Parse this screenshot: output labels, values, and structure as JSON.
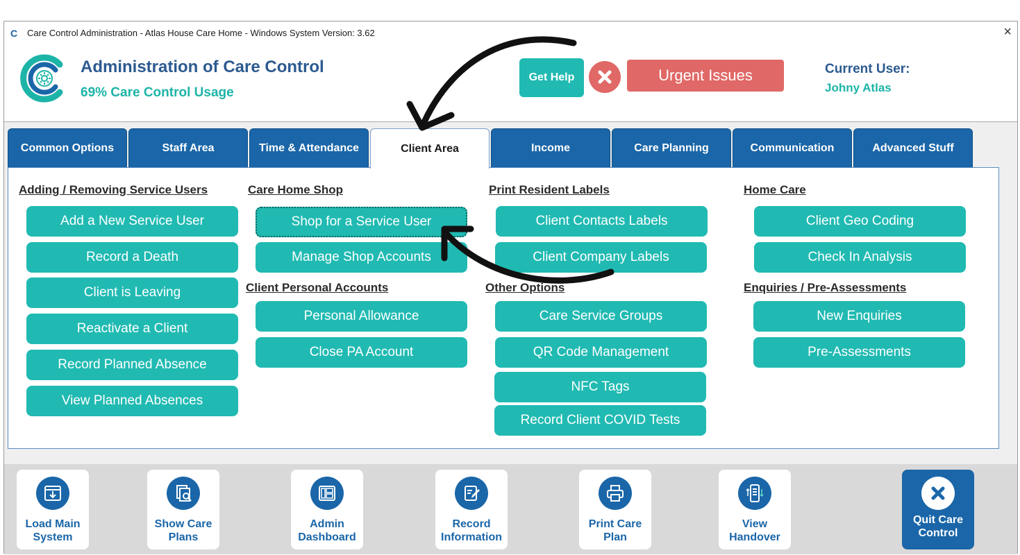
{
  "window": {
    "title": "Care Control Administration - Atlas House Care Home - Windows System Version: 3.62",
    "close_glyph": "×"
  },
  "header": {
    "title": "Administration of Care Control",
    "usage": "69% Care Control Usage",
    "get_help": "Get Help",
    "urgent": "Urgent Issues",
    "current_user_label": "Current User:",
    "current_user_name": "Johny Atlas"
  },
  "tabs": [
    {
      "label": "Common Options",
      "active": false
    },
    {
      "label": "Staff Area",
      "active": false
    },
    {
      "label": "Time & Attendance",
      "active": false
    },
    {
      "label": "Client Area",
      "active": true
    },
    {
      "label": "Income",
      "active": false
    },
    {
      "label": "Care Planning",
      "active": false
    },
    {
      "label": "Communication",
      "active": false
    },
    {
      "label": "Advanced Stuff",
      "active": false
    }
  ],
  "sections": {
    "adding_removing": {
      "heading": "Adding / Removing Service Users",
      "buttons": [
        "Add a New Service User",
        "Record a Death",
        "Client is Leaving",
        "Reactivate a Client",
        "Record Planned Absence",
        "View Planned Absences"
      ]
    },
    "care_home_shop": {
      "heading": "Care Home Shop",
      "buttons": [
        "Shop for a Service User",
        "Manage Shop Accounts"
      ]
    },
    "client_personal_accounts": {
      "heading": "Client Personal Accounts",
      "buttons": [
        "Personal Allowance",
        "Close PA Account"
      ]
    },
    "print_resident_labels": {
      "heading": "Print Resident Labels",
      "buttons": [
        "Client Contacts Labels",
        "Client Company Labels"
      ]
    },
    "other_options": {
      "heading": "Other Options",
      "buttons": [
        "Care Service Groups",
        "QR Code Management",
        "NFC Tags",
        "Record Client COVID Tests"
      ]
    },
    "home_care": {
      "heading": "Home Care",
      "buttons": [
        "Client Geo Coding",
        "Check In Analysis"
      ]
    },
    "enquiries": {
      "heading": "Enquiries / Pre-Assessments",
      "buttons": [
        "New Enquiries",
        "Pre-Assessments"
      ]
    }
  },
  "bottom": [
    {
      "line1": "Load Main",
      "line2": "System",
      "icon": "download-icon"
    },
    {
      "line1": "Show Care",
      "line2": "Plans",
      "icon": "care-plans-search-icon"
    },
    {
      "line1": "Admin",
      "line2": "Dashboard",
      "icon": "dashboard-icon"
    },
    {
      "line1": "Record",
      "line2": "Information",
      "icon": "edit-document-icon"
    },
    {
      "line1": "Print Care",
      "line2": "Plan",
      "icon": "printer-icon"
    },
    {
      "line1": "View",
      "line2": "Handover",
      "icon": "handover-icon"
    },
    {
      "line1": "Quit Care",
      "line2": "Control",
      "icon": "close-circle-icon"
    }
  ],
  "colors": {
    "teal": "#20bab2",
    "blue": "#1a66a8",
    "red": "#e06866",
    "title_blue": "#2c5a90"
  }
}
